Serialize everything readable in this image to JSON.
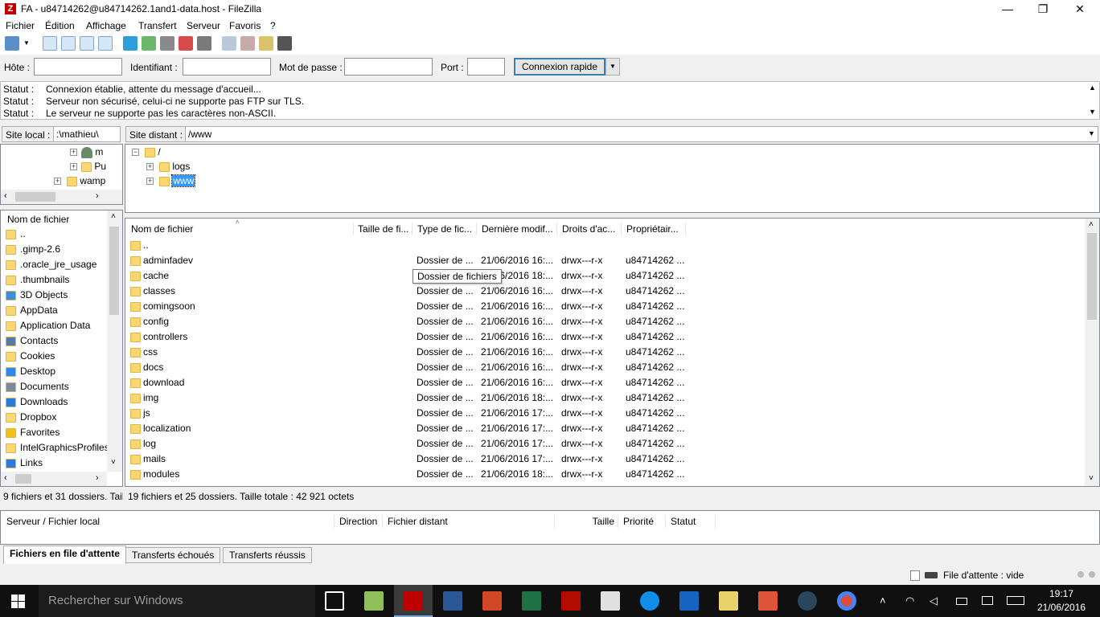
{
  "window": {
    "title": "FA - u84714262@u84714262.1and1-data.host - FileZilla",
    "app_icon_letter": "Z",
    "minimize": "—",
    "maximize": "❐",
    "close": "✕"
  },
  "menu": [
    "Fichier",
    "Édition",
    "Affichage",
    "Transfert",
    "Serveur",
    "Favoris",
    "?"
  ],
  "quickconnect": {
    "host_label": "Hôte :",
    "host_value": "",
    "user_label": "Identifiant :",
    "user_value": "",
    "pass_label": "Mot de passe :",
    "pass_value": "",
    "port_label": "Port :",
    "port_value": "",
    "connect_label": "Connexion rapide",
    "dropdown": "▼"
  },
  "log": [
    {
      "k": "Statut :",
      "v": "Connexion établie, attente du message d'accueil..."
    },
    {
      "k": "Statut :",
      "v": "Serveur non sécurisé, celui-ci ne supporte pas FTP sur TLS."
    },
    {
      "k": "Statut :",
      "v": "Le serveur ne supporte pas les caractères non-ASCII."
    }
  ],
  "local": {
    "site_label": "Site local :",
    "path": ":\\mathieu\\",
    "tree": [
      {
        "name": "m",
        "icon": "user-icon"
      },
      {
        "name": "Pu",
        "icon": "folder-icon"
      },
      {
        "name": "wamp",
        "icon": "folder-icon"
      }
    ],
    "header": "Nom de fichier",
    "files": [
      {
        "name": "..",
        "icon": "folder-icon"
      },
      {
        "name": ".gimp-2.6",
        "icon": "folder-icon"
      },
      {
        "name": ".oracle_jre_usage",
        "icon": "folder-icon"
      },
      {
        "name": ".thumbnails",
        "icon": "folder-icon"
      },
      {
        "name": "3D Objects",
        "icon": "cube-icon"
      },
      {
        "name": "AppData",
        "icon": "folder-icon"
      },
      {
        "name": "Application Data",
        "icon": "folder-icon"
      },
      {
        "name": "Contacts",
        "icon": "contacts-icon"
      },
      {
        "name": "Cookies",
        "icon": "folder-icon"
      },
      {
        "name": "Desktop",
        "icon": "desktop-icon"
      },
      {
        "name": "Documents",
        "icon": "documents-icon"
      },
      {
        "name": "Downloads",
        "icon": "download-icon"
      },
      {
        "name": "Dropbox",
        "icon": "folder-icon"
      },
      {
        "name": "Favorites",
        "icon": "star-icon"
      },
      {
        "name": "IntelGraphicsProfiles",
        "icon": "folder-icon"
      },
      {
        "name": "Links",
        "icon": "link-icon"
      }
    ],
    "status": "9 fichiers et 31 dossiers. Taille"
  },
  "remote": {
    "site_label": "Site distant :",
    "path": "/www",
    "tree": [
      {
        "name": "/"
      },
      {
        "name": "logs"
      },
      {
        "name": "www"
      }
    ],
    "columns": [
      "Nom de fichier",
      "Taille de fi...",
      "Type de fic...",
      "Dernière modif...",
      "Droits d'ac...",
      "Propriétair..."
    ],
    "files": [
      {
        "name": "..",
        "size": "",
        "type": "",
        "modified": "",
        "perms": "",
        "owner": ""
      },
      {
        "name": "adminfadev",
        "size": "",
        "type": "Dossier de ...",
        "modified": "21/06/2016 16:...",
        "perms": "drwx---r-x",
        "owner": "u84714262 ..."
      },
      {
        "name": "cache",
        "size": "",
        "type": "Dossier de ...",
        "modified": "21/06/2016 18:...",
        "perms": "drwx---r-x",
        "owner": "u84714262 ..."
      },
      {
        "name": "classes",
        "size": "",
        "type": "Dossier de ...",
        "modified": "21/06/2016 16:...",
        "perms": "drwx---r-x",
        "owner": "u84714262 ..."
      },
      {
        "name": "comingsoon",
        "size": "",
        "type": "Dossier de ...",
        "modified": "21/06/2016 16:...",
        "perms": "drwx---r-x",
        "owner": "u84714262 ..."
      },
      {
        "name": "config",
        "size": "",
        "type": "Dossier de ...",
        "modified": "21/06/2016 16:...",
        "perms": "drwx---r-x",
        "owner": "u84714262 ..."
      },
      {
        "name": "controllers",
        "size": "",
        "type": "Dossier de ...",
        "modified": "21/06/2016 16:...",
        "perms": "drwx---r-x",
        "owner": "u84714262 ..."
      },
      {
        "name": "css",
        "size": "",
        "type": "Dossier de ...",
        "modified": "21/06/2016 16:...",
        "perms": "drwx---r-x",
        "owner": "u84714262 ..."
      },
      {
        "name": "docs",
        "size": "",
        "type": "Dossier de ...",
        "modified": "21/06/2016 16:...",
        "perms": "drwx---r-x",
        "owner": "u84714262 ..."
      },
      {
        "name": "download",
        "size": "",
        "type": "Dossier de ...",
        "modified": "21/06/2016 16:...",
        "perms": "drwx---r-x",
        "owner": "u84714262 ..."
      },
      {
        "name": "img",
        "size": "",
        "type": "Dossier de ...",
        "modified": "21/06/2016 18:...",
        "perms": "drwx---r-x",
        "owner": "u84714262 ..."
      },
      {
        "name": "js",
        "size": "",
        "type": "Dossier de ...",
        "modified": "21/06/2016 17:...",
        "perms": "drwx---r-x",
        "owner": "u84714262 ..."
      },
      {
        "name": "localization",
        "size": "",
        "type": "Dossier de ...",
        "modified": "21/06/2016 17:...",
        "perms": "drwx---r-x",
        "owner": "u84714262 ..."
      },
      {
        "name": "log",
        "size": "",
        "type": "Dossier de ...",
        "modified": "21/06/2016 17:...",
        "perms": "drwx---r-x",
        "owner": "u84714262 ..."
      },
      {
        "name": "mails",
        "size": "",
        "type": "Dossier de ...",
        "modified": "21/06/2016 17:...",
        "perms": "drwx---r-x",
        "owner": "u84714262 ..."
      },
      {
        "name": "modules",
        "size": "",
        "type": "Dossier de ...",
        "modified": "21/06/2016 18:...",
        "perms": "drwx---r-x",
        "owner": "u84714262 ..."
      }
    ],
    "tooltip": "Dossier de fichiers",
    "status": "19 fichiers et 25 dossiers. Taille totale : 42 921 octets"
  },
  "queue": {
    "columns": [
      "Serveur / Fichier local",
      "Direction",
      "Fichier distant",
      "Taille",
      "Priorité",
      "Statut"
    ]
  },
  "tabs": [
    "Fichiers en file d'attente",
    "Transferts échoués",
    "Transferts réussis"
  ],
  "bottom_status": "File d'attente : vide",
  "taskbar": {
    "search_placeholder": "Rechercher sur Windows",
    "time": "19:17",
    "date": "21/06/2016"
  },
  "colors": {
    "folder": "#fbd774",
    "selection": "#3399ff",
    "accent": "#3c7fb1",
    "filezilla_red": "#bf0000",
    "taskbar": "#101010"
  }
}
